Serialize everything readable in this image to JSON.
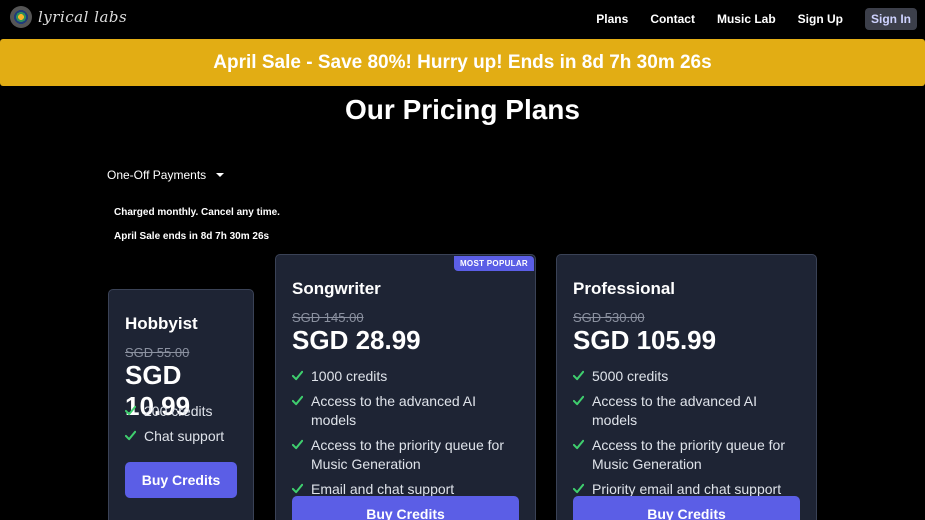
{
  "nav": {
    "logo_text": "lyrical labs",
    "links": [
      "Plans",
      "Contact",
      "Music Lab",
      "Sign Up"
    ],
    "signin_label": "Sign In"
  },
  "banner": {
    "text": "April Sale - Save 80%! Hurry up! Ends in 8d 7h 30m 26s"
  },
  "page": {
    "title": "Our Pricing Plans",
    "payment_option": "One-Off Payments",
    "note_charged": "Charged monthly. Cancel any time.",
    "note_sale": "April Sale ends in 8d 7h 30m 26s"
  },
  "plans": [
    {
      "name": "Hobbyist",
      "old_price": "SGD 55.00",
      "price": "SGD 10.99",
      "features": [
        "200 credits",
        "Chat support"
      ],
      "button": "Buy Credits"
    },
    {
      "name": "Songwriter",
      "badge": "MOST POPULAR",
      "old_price": "SGD 145.00",
      "price": "SGD 28.99",
      "features": [
        "1000 credits",
        "Access to the advanced AI models",
        "Access to the priority queue for Music Generation",
        "Email and chat support"
      ],
      "button": "Buy Credits"
    },
    {
      "name": "Professional",
      "old_price": "SGD 530.00",
      "price": "SGD 105.99",
      "features": [
        "5000 credits",
        "Access to the advanced AI models",
        "Access to the priority queue for Music Generation",
        "Priority email and chat support"
      ],
      "button": "Buy Credits"
    }
  ],
  "colors": {
    "banner": "#e2ad14",
    "accent": "#5b5ee6",
    "card_bg": "#1e2434",
    "check": "#3fcf6e"
  }
}
